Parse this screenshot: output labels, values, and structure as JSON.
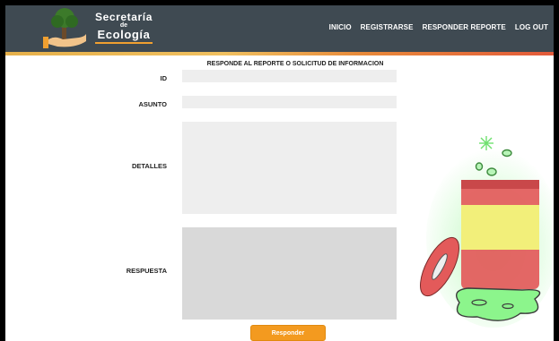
{
  "header": {
    "brand_line1": "Secretaría",
    "brand_line2": "de",
    "brand_line3": "Ecología",
    "bg_color": "#3f4a52",
    "accent_colors": [
      "#e6b04a",
      "#e88a3a",
      "#e35a3a"
    ]
  },
  "nav": {
    "items": [
      {
        "label": "INICIO"
      },
      {
        "label": "REGISTRARSE"
      },
      {
        "label": "RESPONDER REPORTE"
      },
      {
        "label": "LOG OUT"
      }
    ]
  },
  "form": {
    "title": "RESPONDE AL REPORTE O SOLICITUD DE INFORMACION",
    "id_label": "ID",
    "id_value": "",
    "asunto_label": "ASUNTO",
    "asunto_value": "",
    "detalles_label": "DETALLES",
    "detalles_value": "",
    "respuesta_label": "RESPUESTA",
    "respuesta_value": "",
    "submit_label": "Responder",
    "button_color": "#f39a1f"
  },
  "illustration": {
    "icon": "toxic-barrel-icon",
    "barrel_color": "#e35a5a",
    "band_color": "#f2ef7a",
    "spill_color": "#8cf58c"
  }
}
